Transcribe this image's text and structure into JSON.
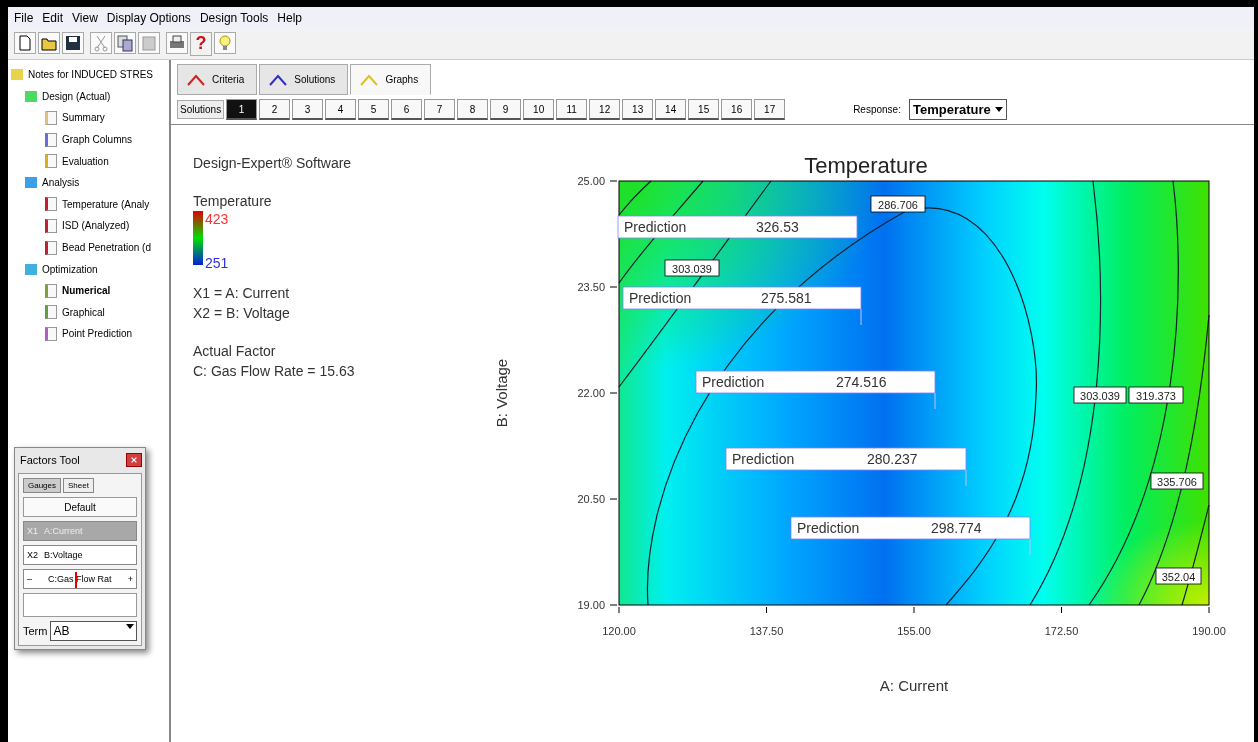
{
  "menu": [
    "File",
    "Edit",
    "View",
    "Display Options",
    "Design Tools",
    "Help"
  ],
  "toolbar": {
    "help_glyph": "?"
  },
  "tree": {
    "label": "Notes for INDUCED STRES",
    "kind": "folder",
    "selected": false,
    "children": [
      {
        "label": "Design (Actual)",
        "kind": "design",
        "selected": false,
        "children": [
          {
            "label": "Summary",
            "kind": "summary",
            "selected": false
          },
          {
            "label": "Graph Columns",
            "kind": "columns",
            "selected": false
          },
          {
            "label": "Evaluation",
            "kind": "evaluation",
            "selected": false
          }
        ]
      },
      {
        "label": "Analysis",
        "kind": "analysis",
        "selected": false,
        "children": [
          {
            "label": "Temperature (Analy",
            "kind": "response",
            "selected": false
          },
          {
            "label": "ISD (Analyzed)",
            "kind": "response",
            "selected": false
          },
          {
            "label": "Bead Penetration (d",
            "kind": "response",
            "selected": false
          }
        ]
      },
      {
        "label": "Optimization",
        "kind": "optimization",
        "selected": false,
        "children": [
          {
            "label": "Numerical",
            "kind": "numerical",
            "selected": true
          },
          {
            "label": "Graphical",
            "kind": "graphical",
            "selected": false
          },
          {
            "label": "Point Prediction",
            "kind": "point",
            "selected": false
          }
        ]
      }
    ]
  },
  "tabs": [
    {
      "label": "Criteria",
      "kind": "criteria",
      "selected": false
    },
    {
      "label": "Solutions",
      "kind": "solutions",
      "selected": false
    },
    {
      "label": "Graphs",
      "kind": "graphs",
      "selected": true
    }
  ],
  "solutions": {
    "label": "Solutions",
    "items": [
      {
        "label": "1",
        "selected": true
      },
      {
        "label": "2",
        "selected": false
      },
      {
        "label": "3",
        "selected": false
      },
      {
        "label": "4",
        "selected": false
      },
      {
        "label": "5",
        "selected": false
      },
      {
        "label": "6",
        "selected": false
      },
      {
        "label": "7",
        "selected": false
      },
      {
        "label": "8",
        "selected": false
      },
      {
        "label": "9",
        "selected": false
      },
      {
        "label": "10",
        "selected": false
      },
      {
        "label": "11",
        "selected": false
      },
      {
        "label": "12",
        "selected": false
      },
      {
        "label": "13",
        "selected": false
      },
      {
        "label": "14",
        "selected": false
      },
      {
        "label": "15",
        "selected": false
      },
      {
        "label": "16",
        "selected": false
      },
      {
        "label": "17",
        "selected": false
      }
    ]
  },
  "response": {
    "label": "Response:",
    "value": "Temperature"
  },
  "legend": {
    "software": "Design-Expert® Software",
    "response": "Temperature",
    "high": "423",
    "low": "251",
    "factors": [
      "X1 = A: Current",
      "X2 = B: Voltage"
    ],
    "actual_factor_heading": "Actual Factor",
    "actual_factor": "C: Gas Flow Rate = 15.63"
  },
  "plot": {
    "title": "Temperature",
    "xlabel": "A: Current",
    "ylabel": "B: Voltage",
    "xticks": [
      "120.00",
      "137.50",
      "155.00",
      "172.50",
      "190.00"
    ],
    "yticks": [
      "25.00",
      "23.50",
      "22.00",
      "20.50",
      "19.00"
    ],
    "contour_labels": [
      "286.706",
      "303.039",
      "303.039",
      "319.373",
      "335.706",
      "352.04"
    ],
    "predictions": [
      {
        "label": "Prediction",
        "value": "326.53"
      },
      {
        "label": "Prediction",
        "value": "275.581"
      },
      {
        "label": "Prediction",
        "value": "274.516"
      },
      {
        "label": "Prediction",
        "value": "280.237"
      },
      {
        "label": "Prediction",
        "value": "298.774"
      }
    ]
  },
  "factors_tool": {
    "title": "Factors Tool",
    "tabs": [
      {
        "label": "Gauges",
        "selected": true
      },
      {
        "label": "Sheet",
        "selected": false
      }
    ],
    "default_button": "Default",
    "factors": [
      {
        "code": "X1",
        "name": "A:Current",
        "selected": true
      },
      {
        "code": "X2",
        "name": "B:Voltage",
        "selected": false
      }
    ],
    "slider": {
      "minus": "–",
      "label": "C:Gas Flow Rat",
      "plus": "+",
      "level": 0.45
    },
    "term_label": "Term",
    "term_value": "AB"
  }
}
